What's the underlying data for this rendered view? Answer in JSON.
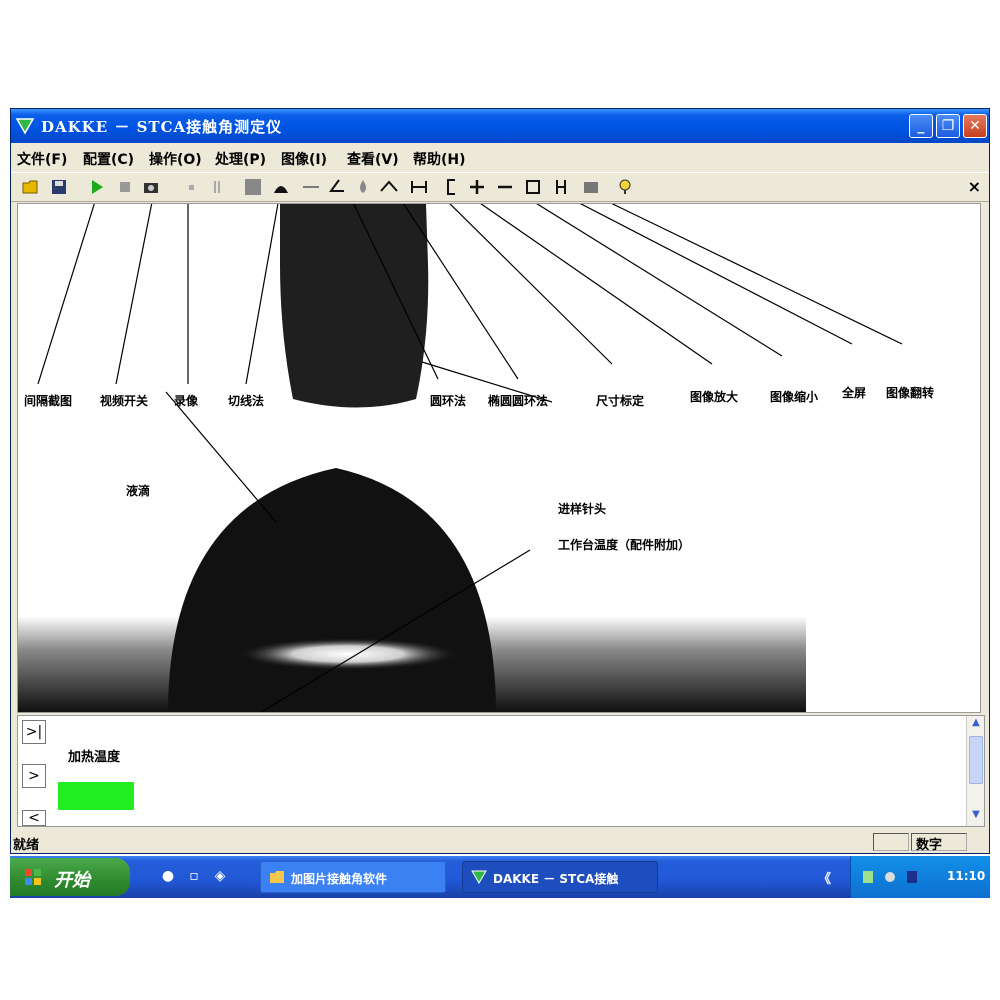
{
  "window": {
    "title": "DAKKE － STCA接触角测定仪",
    "controls": {
      "minimize": "_",
      "maximize": "❐",
      "close": "✕"
    }
  },
  "menu": [
    "文件(F)",
    "配置(C)",
    "操作(O)",
    "处理(P)",
    "图像(I)",
    "查看(V)",
    "帮助(H)"
  ],
  "toolbar": {
    "icons": [
      "open-folder-icon",
      "save-icon",
      "play-icon",
      "stop-icon",
      "camera-icon",
      "record-icon",
      "pause-icon",
      "crop-icon",
      "drop-tangent-icon",
      "baseline-icon",
      "angle-icon",
      "drop-icon",
      "peak-icon",
      "h-measure-icon",
      "bracket-icon",
      "plus-icon",
      "minus-icon",
      "rect-icon",
      "flip-icon",
      "image-icon",
      "help-icon"
    ],
    "close": "×"
  },
  "annotations": {
    "interval_capture": "间隔截图",
    "video_switch": "视频开关",
    "record": "录像",
    "tangent_method": "切线法",
    "circle_fit": "圆环法",
    "ellipse_fit": "椭圆圆环法",
    "size_calibration": "尺寸标定",
    "zoom_in": "图像放大",
    "zoom_out": "图像缩小",
    "fullscreen": "全屏",
    "image_flip": "图像翻转",
    "droplet": "液滴",
    "needle": "进样针头",
    "platform_temp": "工作台温度（配件附加）"
  },
  "bottom_panel": {
    "label": "加热温度",
    "side_buttons": [
      ">|",
      ">",
      "<"
    ],
    "indicator_color": "#22ee22"
  },
  "statusbar": {
    "text": "就绪",
    "field": "数字"
  },
  "taskbar": {
    "start": "开始",
    "tasks": [
      "加图片接触角软件",
      "DAKKE － STCA接触"
    ],
    "tray_chevron": "《",
    "clock": "11:10"
  }
}
